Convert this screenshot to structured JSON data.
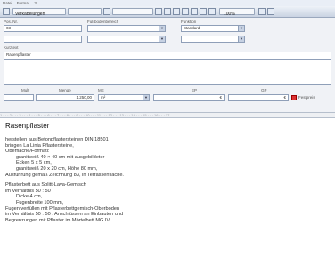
{
  "titlebar": {
    "tabs": [
      "Datei",
      "Format",
      "3"
    ]
  },
  "toolbar": {
    "dropdown_label": "Verkabelungen",
    "zoom": "100%"
  },
  "form": {
    "pos_label": "Pos. Nr.",
    "pos_value": "03",
    "field2_label": "Fußbodenbereich",
    "function_label": "Funktion",
    "function_value": "Standard",
    "shorttext_label": "Kurztext",
    "shorttext_value": "Rasenpflaster",
    "mult_label": "Mult",
    "quantity_label": "Menge",
    "quantity_value": "1.250,00",
    "unit_label": "ME",
    "unit_value": "m²",
    "ep_label": "EP",
    "ep_currency": "€",
    "gp_label": "GP",
    "gp_currency": "€",
    "fixed_price_label": "Festpreis"
  },
  "ruler": {
    "text": "1 · · · 2 · · · 3 · · · 4 · · · 5 · · · 6 · · · 7 · · · 8 · · · 9 · · · 10 · · · 11 · · · 12 · · · 13 · · · 14 · · · 15 · · · 16 · · · 17"
  },
  "doc": {
    "title": "Rasenpflaster",
    "lines": [
      "herstellen aus Betonpflastersteinen DIN 18501",
      "bringen La Linia Pflastersteine,",
      "Oberfläche/Formati:",
      "granitweiß 40 × 40 cm mit ausgebildeter",
      "Ecken 5 x 5 cm,",
      "granitweiß 20 x 20 cm, Höhe 80 mm,",
      "Ausführung gemäß Zeichnung 83, in Terrassenfläche.",
      "Pflasterbett aus Splitt-Lava-Gemisch",
      "im Verhältnis 50 : 50",
      "Dicke 4 cm,",
      "Fugenbreite 100 mm,",
      "Fugen verfüllen mit Pflasterbettgemisch-Oberboden",
      "im Verhältnis 50 : 50 . Anschlüssen an Einbauten und",
      "Begrenzungen mit Pflaster im Mörtelbett MG IV"
    ]
  }
}
